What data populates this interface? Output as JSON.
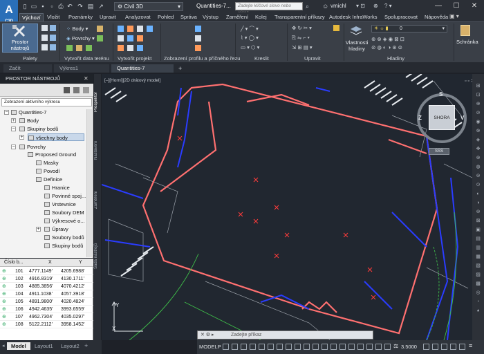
{
  "app": {
    "logo": "A",
    "logo_sub": "C3D",
    "title": "Quantities-7...",
    "workspace": "Civil 3D",
    "search_placeholder": "Zadejte klíčové slovo nebo výraz",
    "user": "vmichl"
  },
  "colors": {
    "accent": "#2a6fb8",
    "canvas_bg": "#212730",
    "road": "#ff6666",
    "utility": "#2a3cff"
  },
  "menu": [
    "Výchozí",
    "Vložit",
    "Poznámky",
    "Upravit",
    "Analyzovat",
    "Pohled",
    "Správa",
    "Výstup",
    "Zaměření",
    "Kolej",
    "Transparentní příkazy",
    "Autodesk InfraWorks",
    "Spolupracovat",
    "Nápověda"
  ],
  "ribbon": {
    "big_button": "Prostor nástrojů",
    "body": "Body",
    "povrchy": "Povrchy",
    "vlastnosti": "Vlastnosti hladiny",
    "layer_value": "0",
    "schranka": "Schránka",
    "panels": [
      "Palety",
      "Vytvořit data terénu",
      "Vytvořit projekt",
      "Zobrazení profilu a příčného řezu",
      "Kreslit",
      "Upravit",
      "Hladiny"
    ]
  },
  "doc_tabs": [
    "Začít",
    "Výkres1",
    "Quantities-7"
  ],
  "toolspace": {
    "title": "PROSTOR NÁSTROJŮ",
    "filter": "Zobrazení aktivního výkresu",
    "tree": [
      {
        "label": "Quantities-7",
        "level": 0
      },
      {
        "label": "Body",
        "level": 1
      },
      {
        "label": "Skupiny bodů",
        "level": 1
      },
      {
        "label": "všechny body",
        "level": 2
      },
      {
        "label": "Povrchy",
        "level": 1
      },
      {
        "label": "Proposed Ground",
        "level": 2
      },
      {
        "label": "Masky",
        "level": 3
      },
      {
        "label": "Povodí",
        "level": 3
      },
      {
        "label": "Definice",
        "level": 3
      },
      {
        "label": "Hranice",
        "level": 4
      },
      {
        "label": "Povinné spoj...",
        "level": 4
      },
      {
        "label": "Vrstevnice",
        "level": 4
      },
      {
        "label": "Soubory DEM",
        "level": 4
      },
      {
        "label": "Výkresové o...",
        "level": 4
      },
      {
        "label": "Úpravy",
        "level": 4
      },
      {
        "label": "Soubory bodů",
        "level": 4
      },
      {
        "label": "Skupiny bodů",
        "level": 4
      }
    ],
    "side_tabs": [
      "Prospektor",
      "Nastavení",
      "Zaměření",
      "Sada nástrojů"
    ]
  },
  "points": {
    "headers": [
      "Číslo b...",
      "X",
      "Y"
    ],
    "rows": [
      [
        "101",
        "4777.1149'",
        "4205.6988'"
      ],
      [
        "102",
        "4916.8319'",
        "4130.1711'"
      ],
      [
        "103",
        "4885.3856'",
        "4070.4212'"
      ],
      [
        "104",
        "4911.1038'",
        "4057.3918'"
      ],
      [
        "105",
        "4891.9800'",
        "4020.4824'"
      ],
      [
        "106",
        "4942.4635'",
        "3993.6559'"
      ],
      [
        "107",
        "4962.7304'",
        "4035.0297'"
      ],
      [
        "108",
        "5122.2112'",
        "3958.1452'"
      ]
    ]
  },
  "canvas": {
    "label": "[–][Horní][2D drátový model]",
    "viewcube_top": "S",
    "viewcube_face": "SHORA",
    "viewcube_west": "Z",
    "viewcube_east": "V",
    "wcs": "SSS",
    "axis_x": "X",
    "axis_y": "Y"
  },
  "layout_tabs": [
    "Model",
    "Layout1",
    "Layout2"
  ],
  "status": {
    "command_placeholder": "Zadejte příkaz",
    "modelp": "MODELP",
    "scale": "3.5000"
  }
}
